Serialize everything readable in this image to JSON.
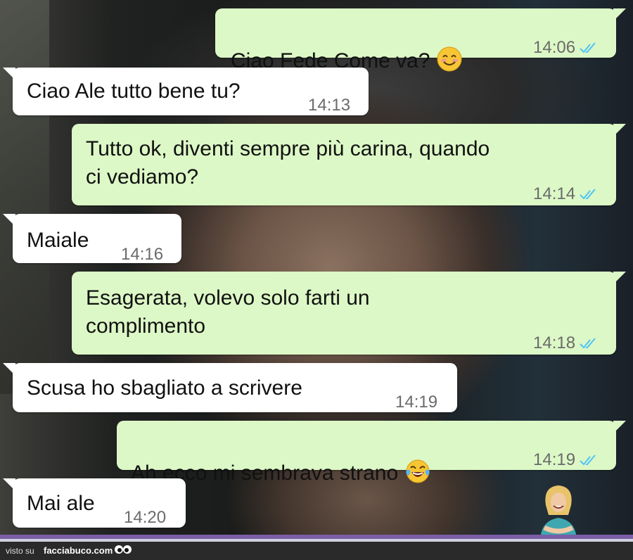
{
  "colors": {
    "incoming_bubble": "#ffffff",
    "outgoing_bubble": "#dcf8c6",
    "read_ticks": "#4fc3f7",
    "footer_bar": "#7b5ea7"
  },
  "messages": [
    {
      "direction": "outgoing",
      "text": "Ciao Fede Come va?",
      "emoji": "smiling-face",
      "time": "14:06",
      "read": true
    },
    {
      "direction": "incoming",
      "text": "Ciao Ale tutto bene tu?",
      "time": "14:13"
    },
    {
      "direction": "outgoing",
      "text": "Tutto ok, diventi sempre più carina, quando\nci vediamo?",
      "time": "14:14",
      "read": true
    },
    {
      "direction": "incoming",
      "text": "Maiale",
      "time": "14:16"
    },
    {
      "direction": "outgoing",
      "text": "Esagerata, volevo solo farti un\ncomplimento",
      "time": "14:18",
      "read": true
    },
    {
      "direction": "incoming",
      "text": "Scusa ho sbagliato a scrivere",
      "time": "14:19"
    },
    {
      "direction": "outgoing",
      "text": "Ah ecco mi sembrava strano",
      "emoji": "face-with-tears-of-joy",
      "time": "14:19",
      "read": true
    },
    {
      "direction": "incoming",
      "text": "Mai ale",
      "time": "14:20"
    }
  ],
  "footer": {
    "visto_su": "visto su",
    "brand": "facciabuco.com"
  }
}
